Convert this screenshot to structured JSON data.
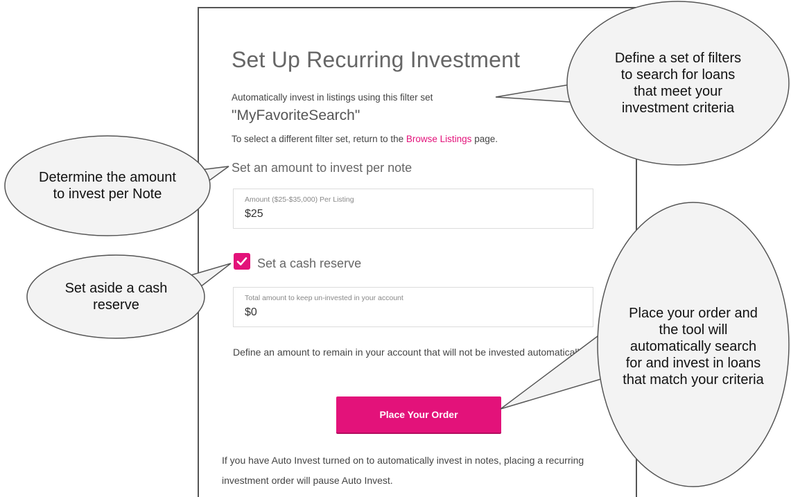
{
  "dialog": {
    "title": "Set Up Recurring Investment",
    "subtitle": "Automatically invest in listings using this filter set",
    "filter_name": "\"MyFavoriteSearch\"",
    "hint_prefix": "To select a different filter set, return to the ",
    "hint_link": "Browse Listings",
    "hint_suffix": " page.",
    "amount_section_label": "Set an amount to invest per note",
    "amount_field": {
      "label": "Amount ($25-$35,000) Per Listing",
      "value": "$25"
    },
    "cash_reserve": {
      "checked": true,
      "label": "Set a cash reserve"
    },
    "reserve_field": {
      "label": "Total amount to keep un-invested in your account",
      "value": "$0"
    },
    "reserve_description": "Define an amount to remain in your account that will not be invested automatically.",
    "order_button_label": "Place Your Order",
    "footer_note": "If you have Auto Invest turned on to automatically invest in notes, placing a recurring investment order will pause Auto Invest."
  },
  "callouts": {
    "filters": "Define a set of filters to search for loans that meet your investment criteria",
    "amount": "Determine the amount to invest per Note",
    "reserve": "Set aside a cash reserve",
    "order": "Place your order and the tool will automatically search for and invest in loans that match your criteria"
  },
  "colors": {
    "accent": "#e3127a",
    "callout_fill": "#f3f3f3"
  }
}
